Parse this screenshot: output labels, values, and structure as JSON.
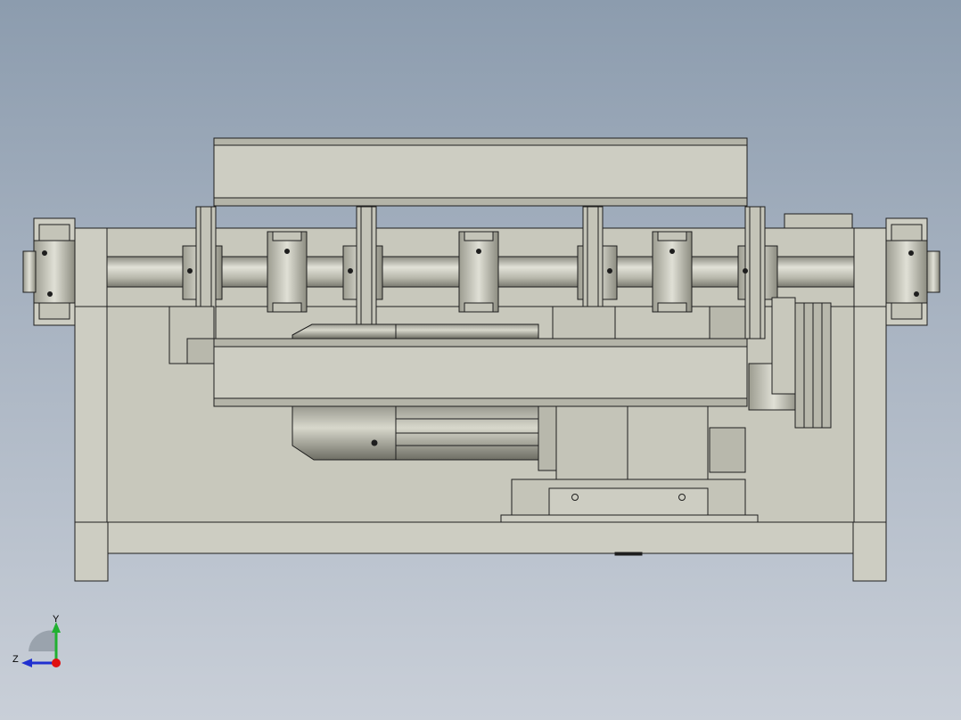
{
  "view": {
    "kind": "cad-assembly-front-view",
    "background_top": "#8c9cae",
    "background_bottom": "#c9cfd8",
    "part_fill": "#cdcdc2",
    "part_fill_dark": "#a8a89c",
    "edge_color": "#1e1e1e"
  },
  "triad": {
    "y_label": "Y",
    "z_label": "Z",
    "y_color": "#20b030",
    "z_color": "#2030d0",
    "origin_color": "#e01010"
  }
}
